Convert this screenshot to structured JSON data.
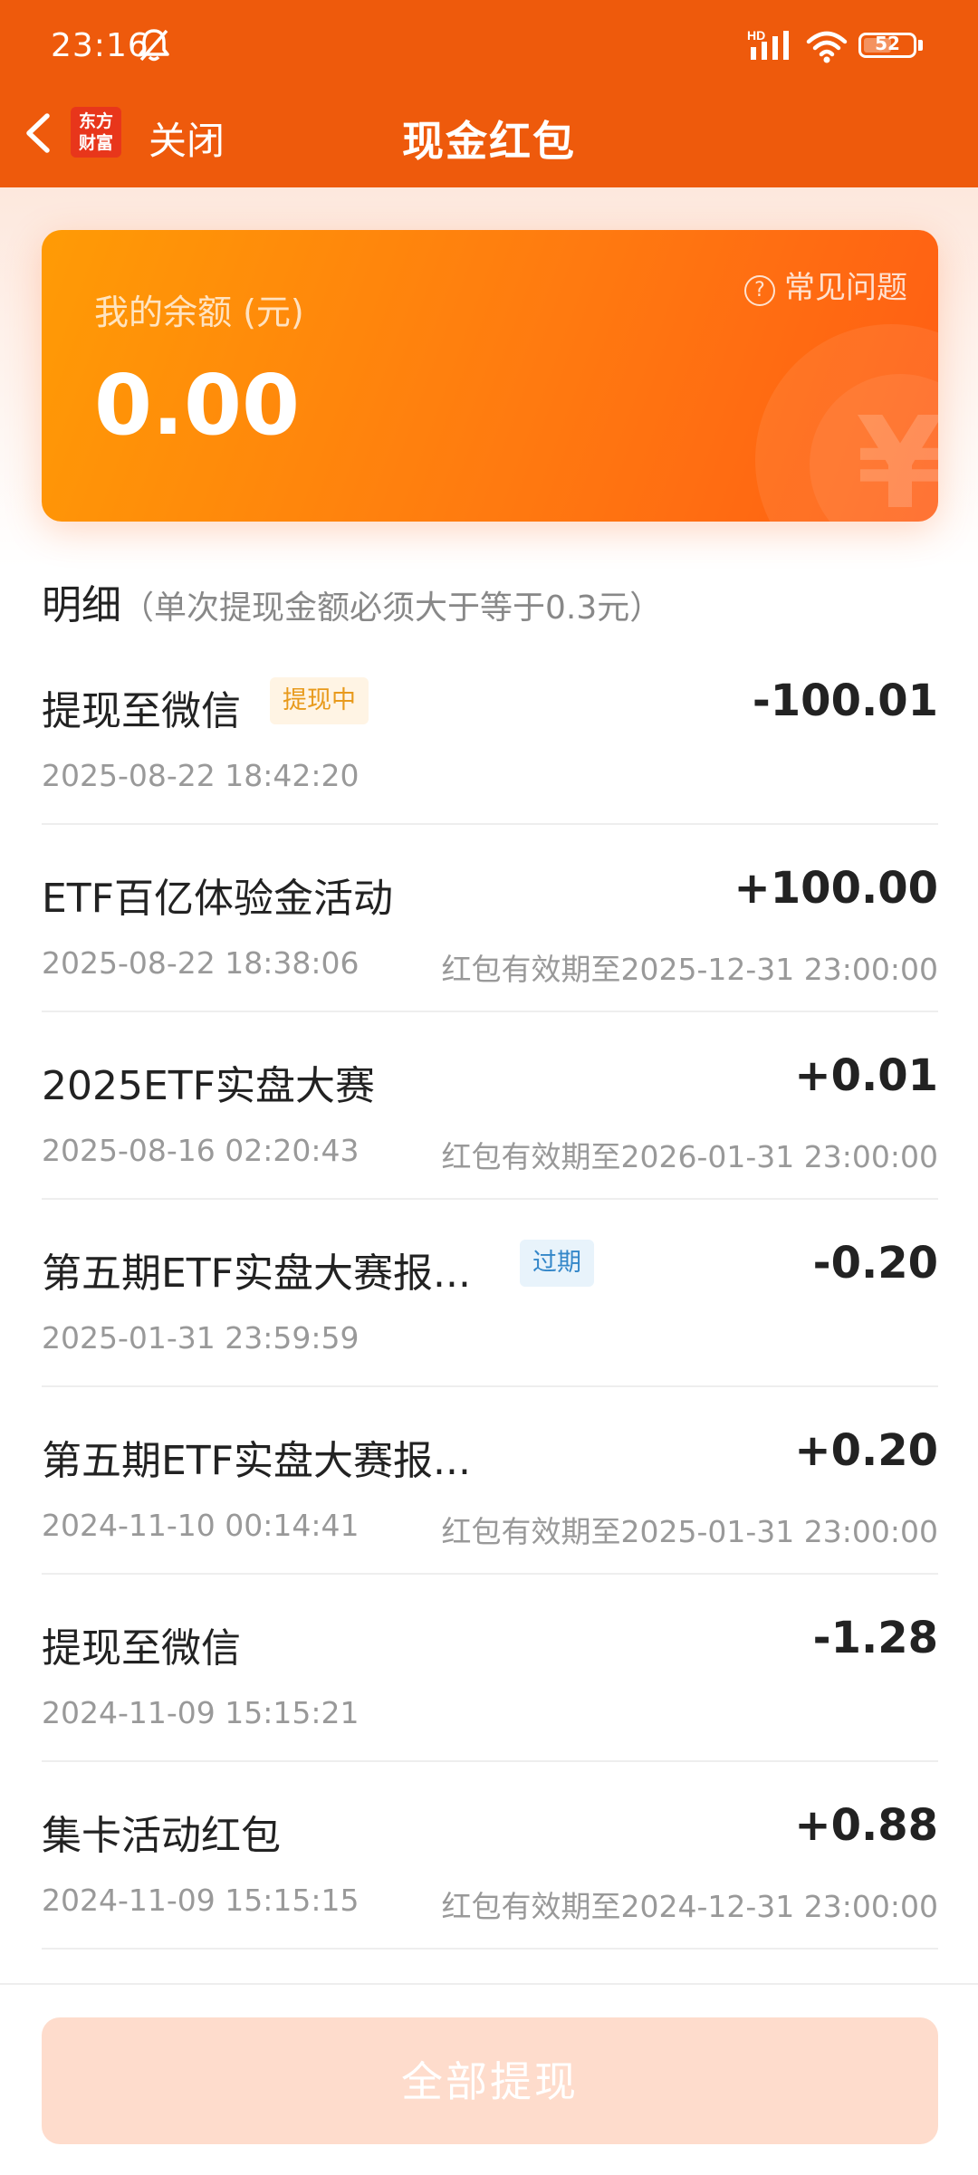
{
  "status_bar": {
    "time": "23:16",
    "hd_label": "HD",
    "battery": "52"
  },
  "nav": {
    "logo_line1": "东方",
    "logo_line2": "财富",
    "close_label": "关闭",
    "title": "现金红包"
  },
  "balance": {
    "label": "我的余额 (元)",
    "value": "0.00",
    "faq_label": "常见问题",
    "coin_symbol": "¥"
  },
  "details": {
    "title": "明细",
    "note": "（单次提现金额必须大于等于0.3元）",
    "items": [
      {
        "title": "提现至微信",
        "tag": "提现中",
        "date": "2025-08-22 18:42:20",
        "amount": "-100.01",
        "expiry": ""
      },
      {
        "title": "ETF百亿体验金活动",
        "tag": "",
        "date": "2025-08-22 18:38:06",
        "amount": "+100.00",
        "expiry": "红包有效期至2025-12-31 23:00:00"
      },
      {
        "title": "2025ETF实盘大赛",
        "tag": "",
        "date": "2025-08-16 02:20:43",
        "amount": "+0.01",
        "expiry": "红包有效期至2026-01-31 23:00:00"
      },
      {
        "title": "第五期ETF实盘大赛报...",
        "tag": "过期",
        "date": "2025-01-31 23:59:59",
        "amount": "-0.20",
        "expiry": ""
      },
      {
        "title": "第五期ETF实盘大赛报...",
        "tag": "",
        "date": "2024-11-10 00:14:41",
        "amount": "+0.20",
        "expiry": "红包有效期至2025-01-31 23:00:00"
      },
      {
        "title": "提现至微信",
        "tag": "",
        "date": "2024-11-09 15:15:21",
        "amount": "-1.28",
        "expiry": ""
      },
      {
        "title": "集卡活动红包",
        "tag": "",
        "date": "2024-11-09 15:15:15",
        "amount": "+0.88",
        "expiry": "红包有效期至2024-12-31 23:00:00"
      }
    ]
  },
  "bottom": {
    "withdraw_all_label": "全部提现"
  },
  "colors": {
    "header_bg": "#ee5a0c",
    "card_gradient_start": "#ff9b05",
    "card_gradient_end": "#ff5d14",
    "tag_withdraw_text": "#e89a1c",
    "tag_expired_text": "#3487c9",
    "button_disabled_bg": "#fedccc"
  },
  "icons": [
    "back-arrow-icon",
    "silent-bell-icon",
    "signal-icon",
    "wifi-icon",
    "battery-icon",
    "help-circle-icon",
    "yuan-coin-icon"
  ]
}
